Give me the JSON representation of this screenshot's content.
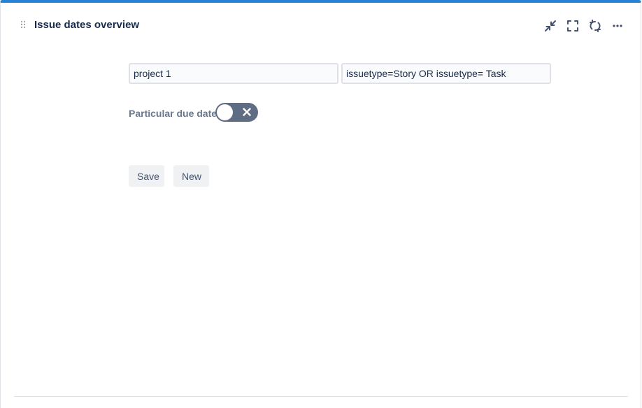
{
  "gadget": {
    "title": "Issue dates overview",
    "accent_color": "#2684d6",
    "icons": {
      "drag": "drag-handle-icon",
      "minimize": "minimize-icon",
      "fullscreen": "fullscreen-icon",
      "refresh": "refresh-icon",
      "more": "more-icon"
    }
  },
  "form": {
    "project_field": {
      "value": "project 1"
    },
    "jql_field": {
      "value": "issuetype=Story OR issuetype= Task"
    },
    "toggle": {
      "label": "Particular due date",
      "state": "off",
      "color": "#5e6c84"
    },
    "buttons": {
      "save_label": "Save",
      "new_label": "New"
    }
  }
}
